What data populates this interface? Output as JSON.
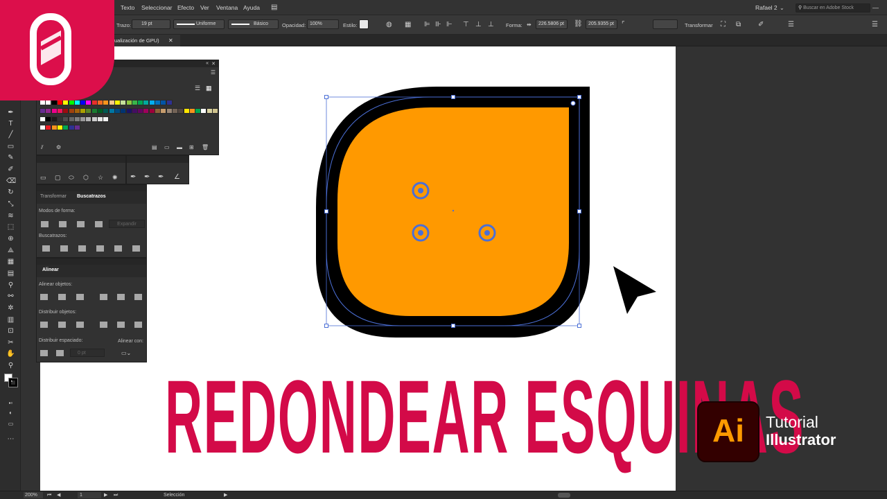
{
  "menu": [
    "Texto",
    "Seleccionar",
    "Efecto",
    "Ver",
    "Ventana",
    "Ayuda"
  ],
  "user": "Rafael 2",
  "search_placeholder": "Buscar en Adobe Stock",
  "control": {
    "stroke_label": "Trazo:",
    "stroke_weight": "19 pt",
    "stroke_profile": "Uniforme",
    "brush": "Básico",
    "opacity_label": "Opacidad:",
    "opacity": "100%",
    "style_label": "Estilo:",
    "shape_label": "Forma:",
    "width_value": "226.5806 pt",
    "height_value": "205.9355 pt",
    "transform_label": "Transformar"
  },
  "doc_tab": "ualización de GPU)",
  "pathfinder": {
    "tab_transform": "Transformar",
    "tab_pathfinder": "Buscatrazos",
    "shape_modes": "Modos de forma:",
    "expand": "Expandir",
    "pathfinders": "Buscatrazos:"
  },
  "align": {
    "tab": "Alinear",
    "align_objects": "Alinear objetos:",
    "distribute_objects": "Distribuir objetos:",
    "distribute_spacing": "Distribuir espaciado:",
    "align_to": "Alinear con:",
    "spacing_value": "0 pt"
  },
  "status": {
    "zoom": "200%",
    "page": "1",
    "mode": "Selección"
  },
  "title": "REDONDEAR ESQUINAS",
  "badge": {
    "ai": "Ai",
    "line1": "Tutorial",
    "line2": "Illustrator"
  },
  "colors": {
    "accent": "#dc0f4b",
    "shape_fill": "#ff9900",
    "shape_stroke": "#000000",
    "selection": "#4b6fd6"
  },
  "swatches": [
    [
      "#ffffff",
      "#ffffff",
      "#000000",
      "#ff0000",
      "#ffff00",
      "#00ff00",
      "#00ffff",
      "#0000ff",
      "#ff00ff",
      "#e8302a",
      "#f26b21",
      "#f7941d",
      "#fdc689",
      "#fff200",
      "#c4df9b",
      "#8dc63f",
      "#39b54a",
      "#00a651",
      "#00a99d",
      "#00aeef",
      "#0072bc",
      "#0054a6",
      "#2e3192"
    ],
    [
      "#662d91",
      "#92278f",
      "#ec008c",
      "#ed145b",
      "#9e0b0f",
      "#a0410d",
      "#a3620a",
      "#aba000",
      "#598527",
      "#197b30",
      "#005e20",
      "#005952",
      "#0076a3",
      "#004a80",
      "#003471",
      "#1b1464",
      "#440e62",
      "#630460",
      "#9e005d",
      "#9e0039",
      "#8c6239",
      "#c69c6d",
      "#998675",
      "#736357",
      "#534741",
      "#ffe600",
      "#f7941d",
      "#00a651",
      "#ffffff",
      "#d9d2a0",
      "#cfc38e"
    ],
    [
      "#ffffff",
      "#000000",
      "#1a1a1a",
      "#333333",
      "#4d4d4d",
      "#666666",
      "#808080",
      "#999999",
      "#b3b3b3",
      "#cccccc",
      "#e6e6e6",
      "#f2f2f2"
    ],
    [
      "#ffffff",
      "#ed1c24",
      "#f7941d",
      "#fff200",
      "#00a651",
      "#2e3192",
      "#662d91"
    ]
  ]
}
